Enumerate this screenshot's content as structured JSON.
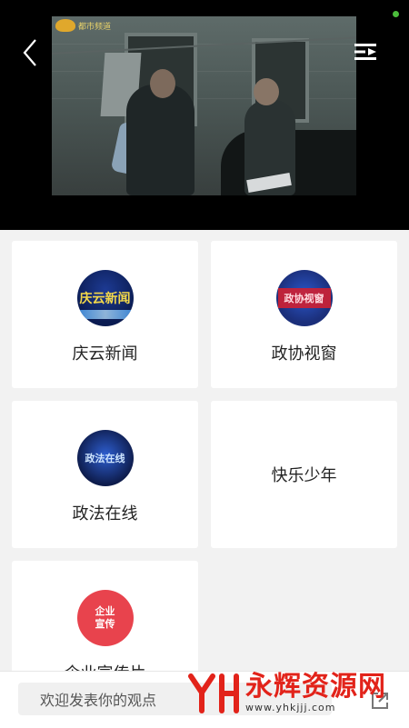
{
  "player": {
    "channel_logo_text": "都市频道",
    "back_icon": "chevron-left-icon",
    "playlist_icon": "playlist-icon"
  },
  "cards": [
    {
      "label": "庆云新闻",
      "thumb_text": "庆云新闻",
      "thumb_style": "qy"
    },
    {
      "label": "政协视窗",
      "thumb_text": "政协视窗",
      "thumb_style": "zx"
    },
    {
      "label": "政法在线",
      "thumb_text": "政法在线",
      "thumb_style": "zf"
    },
    {
      "label": "快乐少年"
    },
    {
      "label": "企业宣传片",
      "thumb_text": "企业宣传",
      "thumb_style": "qc"
    }
  ],
  "comment": {
    "placeholder": "欢迎发表你的观点",
    "share_icon": "share-icon"
  },
  "watermark": {
    "title": "永辉资源网",
    "url": "www.yhkjjj.com"
  },
  "colors": {
    "status_dot": "#4bbd3b",
    "watermark_red": "#e2231a"
  }
}
